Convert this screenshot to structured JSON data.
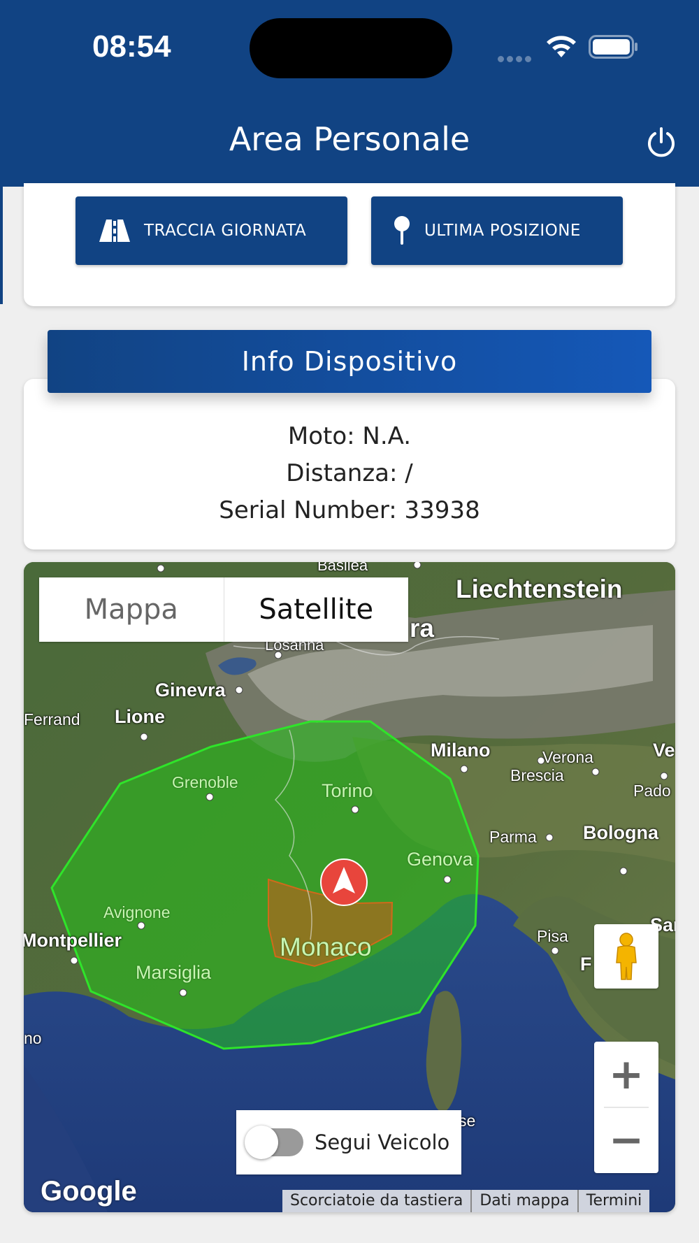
{
  "status_bar": {
    "time": "08:54"
  },
  "header": {
    "title": "Area Personale",
    "power_icon": "power-icon"
  },
  "actions": {
    "track_day": {
      "label": "TRACCIA GIORNATA",
      "icon": "road-icon"
    },
    "last_position": {
      "label": "ULTIMA POSIZIONE",
      "icon": "map-pin-icon"
    }
  },
  "device_info": {
    "title": "Info Dispositivo",
    "moto": "Moto: N.A.",
    "distance": "Distanza: /",
    "serial": "Serial Number: 33938"
  },
  "map": {
    "type_control": {
      "map": "Mappa",
      "satellite": "Satellite",
      "selected": "Satellite"
    },
    "labels": {
      "liechtenstein": "Liechtenstein",
      "basilea": "Basilea",
      "losanna": "Losanna",
      "ra": "ra",
      "ginevra": "Ginevra",
      "ferrand": "Ferrand",
      "lione": "Lione",
      "milano": "Milano",
      "verona": "Verona",
      "ve": "Ve",
      "brescia": "Brescia",
      "pado": "Pado",
      "grenoble": "Grenoble",
      "torino": "Torino",
      "parma": "Parma",
      "bologna": "Bologna",
      "genova": "Genova",
      "avignone": "Avignone",
      "montpellier": "Montpellier",
      "monaco": "Monaco",
      "pisa": "Pisa",
      "f": "F",
      "sar": "Sar",
      "marsiglia": "Marsiglia",
      "no": "no",
      "se": "se"
    },
    "follow_vehicle": {
      "label": "Segui Veicolo",
      "enabled": false
    },
    "zoom_in": "+",
    "zoom_out": "−",
    "google": "Google",
    "attribution": {
      "shortcuts": "Scorciatoie da tastiera",
      "map_data": "Dati mappa",
      "terms": "Termini"
    },
    "geofence_color": "#22cc22",
    "zone_color": "#b3721a",
    "marker_color": "#e8453c"
  },
  "colors": {
    "primary": "#114383",
    "accent": "#1558b8"
  }
}
